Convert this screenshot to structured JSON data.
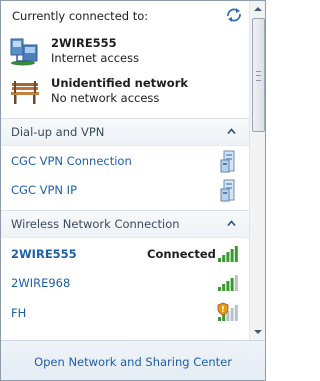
{
  "header": {
    "title": "Currently connected to:"
  },
  "connected": [
    {
      "name": "2WIRE555",
      "status": "Internet access",
      "icon": "network-computers-icon"
    },
    {
      "name": "Unidentified network",
      "status": "No network access",
      "icon": "park-bench-icon"
    }
  ],
  "dialup_group": {
    "title": "Dial-up and VPN",
    "items": [
      {
        "label": "CGC VPN Connection",
        "icon": "vpn-server-icon"
      },
      {
        "label": "CGC VPN IP",
        "icon": "vpn-server-icon"
      }
    ]
  },
  "wireless_group": {
    "title": "Wireless Network Connection",
    "items": [
      {
        "label": "2WIRE555",
        "status": "Connected",
        "signal_bars": 5,
        "secured": false
      },
      {
        "label": "2WIRE968",
        "status": "",
        "signal_bars": 4,
        "secured": false
      },
      {
        "label": "FH",
        "status": "",
        "signal_bars": 2,
        "secured": true
      }
    ]
  },
  "footer": {
    "link": "Open Network and Sharing Center"
  },
  "colors": {
    "link": "#1f5fa6",
    "signal_on": "#3a9a32",
    "signal_off": "#b9c0c8"
  }
}
